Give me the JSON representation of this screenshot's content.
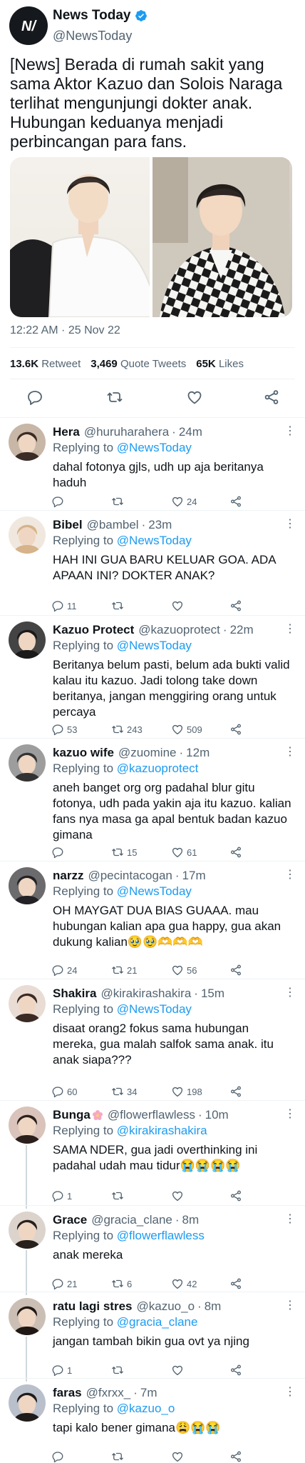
{
  "main_tweet": {
    "author_name": "News Today",
    "author_handle": "@NewsToday",
    "logo_text": "N/",
    "text": "[News] Berada di rumah sakit yang sama Aktor Kazuo dan Solois Naraga terlihat mengunjungi dokter anak. Hubungan keduanya menjadi perbincangan para fans.",
    "timestamp": "12:22 AM · 25 Nov 22",
    "stats": {
      "retweets_value": "13.6K",
      "retweets_label": "Retweet",
      "quotes_value": "3,469",
      "quotes_label": "Quote Tweets",
      "likes_value": "65K",
      "likes_label": "Likes"
    },
    "icons": [
      "reply-icon",
      "retweet-icon",
      "like-icon",
      "share-icon"
    ]
  },
  "replies": [
    {
      "name": "Hera",
      "handle": "@huruharahera",
      "time": "24m",
      "reply_prefix": "Replying to",
      "reply_to": "@NewsToday",
      "text": "dahal fotonya gjls, udh up aja beritanya haduh",
      "counts": {
        "reply": "",
        "retweet": "",
        "like": "24"
      }
    },
    {
      "name": "Bibel",
      "handle": "@bambel",
      "time": "23m",
      "reply_prefix": "Replying to",
      "reply_to": "@NewsToday",
      "text": "HAH INI GUA BARU KELUAR GOA. ADA APAAN INI? DOKTER ANAK?",
      "counts": {
        "reply": "11",
        "retweet": "",
        "like": ""
      }
    },
    {
      "name": "Kazuo Protect",
      "handle": "@kazuoprotect",
      "time": "22m",
      "reply_prefix": "Replying to",
      "reply_to": "@NewsToday",
      "text": "Beritanya belum pasti, belum ada bukti valid kalau itu kazuo. Jadi tolong take down beritanya, jangan menggiring orang untuk percaya",
      "counts": {
        "reply": "53",
        "retweet": "243",
        "like": "509"
      }
    },
    {
      "name": "kazuo wife",
      "handle": "@zuomine",
      "time": "12m",
      "reply_prefix": "Replying to",
      "reply_to": "@kazuoprotect",
      "text": "aneh banget org org padahal blur gitu fotonya, udh pada yakin aja itu kazuo. kalian fans nya masa ga apal bentuk badan kazuo gimana",
      "counts": {
        "reply": "",
        "retweet": "15",
        "like": "61"
      }
    },
    {
      "name": "narzz",
      "handle": "@pecintacogan",
      "time": "17m",
      "reply_prefix": "Replying to",
      "reply_to": "@NewsToday",
      "text": "OH MAYGAT DUA BIAS GUAAA. mau hubungan kalian apa gua happy, gua akan dukung kalian🥹🥹🫶🫶🫶",
      "counts": {
        "reply": "24",
        "retweet": "21",
        "like": "56"
      }
    },
    {
      "name": "Shakira",
      "handle": "@kirakirashakira",
      "time": "15m",
      "reply_prefix": "Replying to",
      "reply_to": "@NewsToday",
      "text": "disaat orang2 fokus sama hubungan mereka, gua malah salfok sama anak. itu anak siapa???",
      "counts": {
        "reply": "60",
        "retweet": "34",
        "like": "198"
      }
    },
    {
      "name": "Bunga",
      "handle": "@flowerflawless",
      "time": "10m",
      "reply_prefix": "Replying to",
      "reply_to": "@kirakirashakira",
      "text": "SAMA NDER, gua jadi overthinking ini padahal udah mau tidur😭😭😭😭",
      "counts": {
        "reply": "1",
        "retweet": "",
        "like": ""
      }
    },
    {
      "name": "Grace",
      "handle": "@gracia_clane",
      "time": "8m",
      "reply_prefix": "Replying to",
      "reply_to": "@flowerflawless",
      "text": "anak mereka",
      "counts": {
        "reply": "21",
        "retweet": "6",
        "like": "42"
      }
    },
    {
      "name": "ratu lagi stres",
      "handle": "@kazuo_o",
      "time": "8m",
      "reply_prefix": "Replying to",
      "reply_to": "@gracia_clane",
      "text": "jangan tambah bikin gua ovt ya njing",
      "counts": {
        "reply": "1",
        "retweet": "",
        "like": ""
      }
    },
    {
      "name": "faras",
      "handle": "@fxrxx_",
      "time": "7m",
      "reply_prefix": "Replying to",
      "reply_to": "@kazuo_o",
      "text": "tapi kalo bener gimana😩😭😭",
      "counts": {
        "reply": "",
        "retweet": "",
        "like": ""
      }
    }
  ],
  "colors": {
    "accent": "#1d9bf0",
    "text_primary": "#0f1419",
    "text_secondary": "#536471",
    "divider": "#eff3f4"
  }
}
